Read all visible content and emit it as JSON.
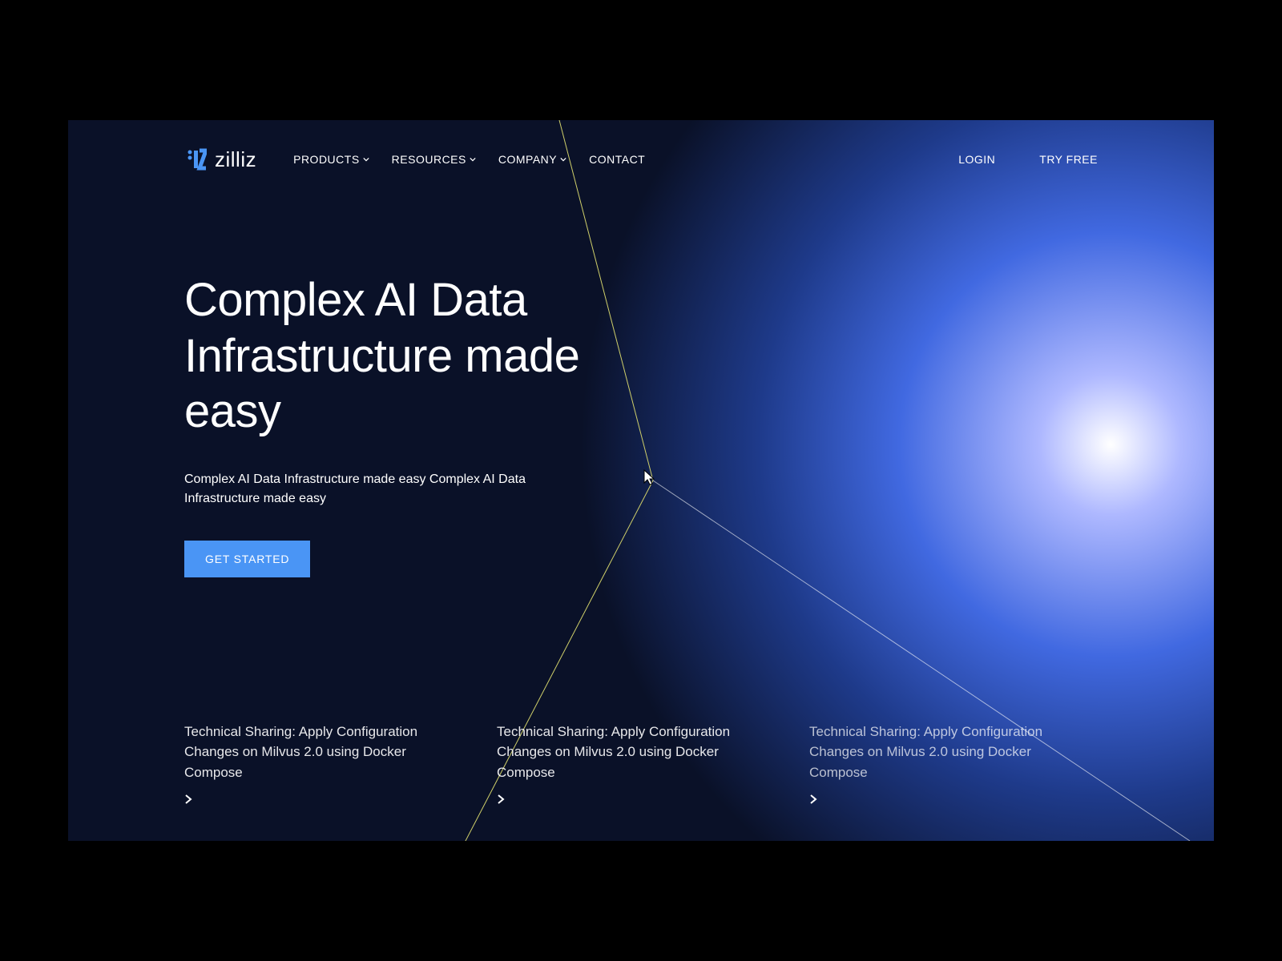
{
  "brand": {
    "name": "zilliz"
  },
  "nav": {
    "items": [
      {
        "label": "PRODUCTS",
        "hasDropdown": true
      },
      {
        "label": "RESOURCES",
        "hasDropdown": true
      },
      {
        "label": "COMPANY",
        "hasDropdown": true
      },
      {
        "label": "CONTACT",
        "hasDropdown": false
      }
    ]
  },
  "headerActions": {
    "login": "LOGIN",
    "tryFree": "TRY FREE"
  },
  "hero": {
    "title": "Complex AI Data Infrastructure made easy",
    "subtitle": "Complex AI Data Infrastructure made easy Complex AI Data Infrastructure made easy",
    "cta": "GET STARTED"
  },
  "cards": [
    {
      "title": "Technical Sharing: Apply Configuration Changes on Milvus 2.0 using Docker Compose"
    },
    {
      "title": "Technical Sharing: Apply Configuration Changes on Milvus 2.0 using Docker Compose"
    },
    {
      "title": "Technical Sharing: Apply Configuration Changes on Milvus 2.0 using Docker Compose"
    }
  ],
  "colors": {
    "accent": "#4a95f5",
    "background": "#0a1128"
  }
}
